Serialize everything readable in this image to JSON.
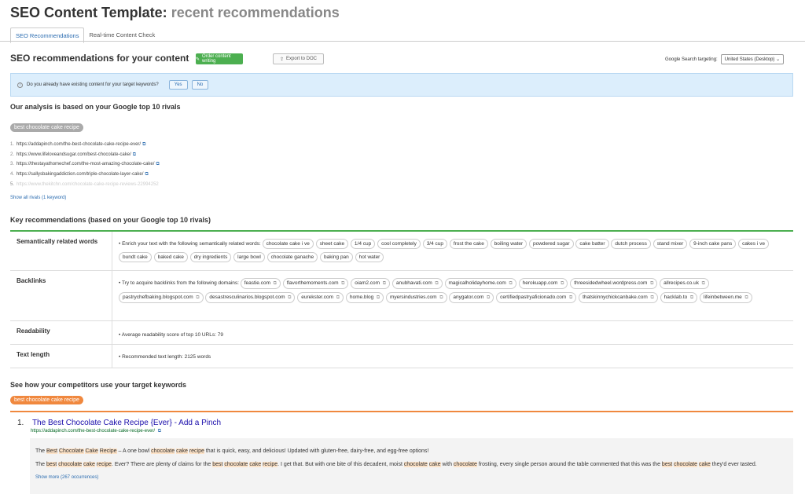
{
  "header": {
    "title": "SEO Content Template:",
    "subtitle": "recent recommendations"
  },
  "tabs": [
    {
      "label": "SEO Recommendations",
      "active": true
    },
    {
      "label": "Real-time Content Check",
      "active": false
    }
  ],
  "recommendations": {
    "title": "SEO recommendations for your content",
    "order_btn": "Order content writing",
    "export_btn": "Export to DOC",
    "targeting_label": "Google Search targeting:",
    "targeting_value": "United States (Desktop)"
  },
  "banner": {
    "question": "Do you already have existing content for your target keywords?",
    "yes": "Yes",
    "no": "No"
  },
  "analysis": {
    "title": "Our analysis is based on your Google top 10 rivals",
    "keyword": "best chocolate cake recipe",
    "rivals": [
      "https://addapinch.com/the-best-chocolate-cake-recipe-ever/",
      "https://www.lifeloveandsugar.com/best-chocolate-cake/",
      "https://thestayathomechef.com/the-most-amazing-chocolate-cake/",
      "https://sallysbakingaddiction.com/triple-chocolate-layer-cake/",
      "https://www.thekitchn.com/chocolate-cake-recipe-reviews-22994252"
    ],
    "show_all": "Show all rivals (1 keyword)"
  },
  "key_recs": {
    "title": "Key recommendations (based on your Google top 10 rivals)",
    "semantic_label": "Semantically related words",
    "semantic_intro": "• Enrich your text with the following semantically related words:",
    "semantic_words": [
      "chocolate cake i ve",
      "sheet cake",
      "1/4 cup",
      "cool completely",
      "3/4 cup",
      "frost the cake",
      "boiling water",
      "powdered sugar",
      "cake batter",
      "dutch process",
      "stand mixer",
      "9-inch cake pans",
      "cakes i ve",
      "bundt cake",
      "baked cake",
      "dry ingredients",
      "large bowl",
      "chocolate ganache",
      "baking pan",
      "hot water"
    ],
    "backlinks_label": "Backlinks",
    "backlinks_intro": "• Try to acquire backlinks from the following domains:",
    "backlink_domains": [
      "feastie.com",
      "flavorthemoments.com",
      "oiam2.com",
      "anubhavati.com",
      "magicalholidayhome.com",
      "herokuapp.com",
      "threesidedwheel.wordpress.com",
      "allrecipes.co.uk",
      "pastrychefbaking.blogspot.com",
      "desastresculinarios.blogspot.com",
      "eurekster.com",
      "home.blog",
      "myersindustries.com",
      "anygator.com",
      "certifiedpastryaficionado.com",
      "thatskinnychickcanbake.com",
      "hacklab.to",
      "lifeinbetween.me"
    ],
    "readability_label": "Readability",
    "readability_text": "• Average readability score of top 10 URLs:",
    "readability_value": "79",
    "length_label": "Text length",
    "length_text": "• Recommended text length:",
    "length_value": "2125 words"
  },
  "competitors": {
    "title": "See how your competitors use your target keywords",
    "keyword": "best chocolate cake recipe",
    "result_num": "1.",
    "result_title": "The Best Chocolate Cake Recipe {Ever} - Add a Pinch",
    "result_url": "https://addapinch.com/the-best-chocolate-cake-recipe-ever/",
    "show_more": "Show more (267 occurrences)"
  },
  "colors": {
    "accent_green": "#4caf50",
    "accent_orange": "#f0883e",
    "link_blue": "#2b6cb0"
  }
}
